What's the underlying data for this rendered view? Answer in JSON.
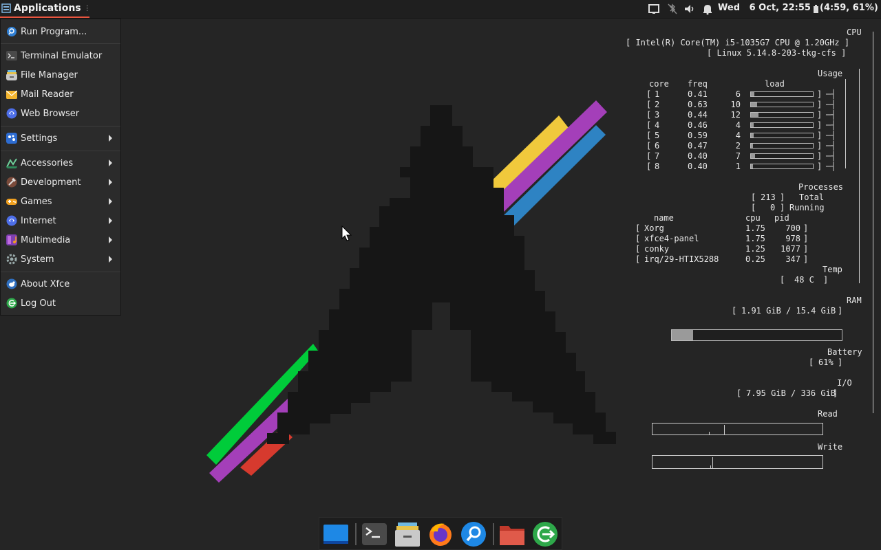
{
  "panel": {
    "apps_label": "Applications",
    "clock": "Wed   6 Oct, 22:55",
    "battery": "(4:59, 61%)"
  },
  "menu": {
    "items": [
      {
        "label": "Run Program...",
        "icon": "search-icon"
      },
      {
        "label": "Terminal Emulator",
        "icon": "terminal-icon"
      },
      {
        "label": "File Manager",
        "icon": "file-manager-icon"
      },
      {
        "label": "Mail Reader",
        "icon": "mail-icon"
      },
      {
        "label": "Web Browser",
        "icon": "web-browser-icon"
      },
      {
        "label": "Settings",
        "icon": "settings-icon"
      },
      {
        "label": "Accessories",
        "icon": "accessories-icon"
      },
      {
        "label": "Development",
        "icon": "development-icon"
      },
      {
        "label": "Games",
        "icon": "games-icon"
      },
      {
        "label": "Internet",
        "icon": "internet-icon"
      },
      {
        "label": "Multimedia",
        "icon": "multimedia-icon"
      },
      {
        "label": "System",
        "icon": "system-icon"
      },
      {
        "label": "About Xfce",
        "icon": "xfce-icon"
      },
      {
        "label": "Log Out",
        "icon": "logout-icon"
      }
    ]
  },
  "conky": {
    "cpu_header": "CPU",
    "cpu_model": "[ Intel(R) Core(TM) i5-1035G7 CPU @ 1.20GHz ]",
    "kernel": "[ Linux 5.14.8-203-tkg-cfs ]",
    "usage_header": "Usage",
    "core_header": "core",
    "freq_header": "freq",
    "load_header": "load",
    "cores": [
      {
        "core": "1",
        "freq": "0.41",
        "load": "6"
      },
      {
        "core": "2",
        "freq": "0.63",
        "load": "10"
      },
      {
        "core": "3",
        "freq": "0.44",
        "load": "12"
      },
      {
        "core": "4",
        "freq": "0.46",
        "load": "4"
      },
      {
        "core": "5",
        "freq": "0.59",
        "load": "4"
      },
      {
        "core": "6",
        "freq": "0.47",
        "load": "2"
      },
      {
        "core": "7",
        "freq": "0.40",
        "load": "7"
      },
      {
        "core": "8",
        "freq": "0.40",
        "load": "1"
      }
    ],
    "processes_header": "Processes",
    "total_count": "213",
    "total_label": "Total",
    "running_count": "0",
    "running_label": "Running",
    "proc_cols": {
      "name": "name",
      "cpu": "cpu",
      "pid": "pid"
    },
    "procs": [
      {
        "name": "Xorg",
        "cpu": "1.75",
        "pid": "700"
      },
      {
        "name": "xfce4-panel",
        "cpu": "1.75",
        "pid": "978"
      },
      {
        "name": "conky",
        "cpu": "1.25",
        "pid": "1077"
      },
      {
        "name": "irq/29-HTIX5288",
        "cpu": "0.25",
        "pid": "347"
      }
    ],
    "temp_header": "Temp",
    "temp": "48 C",
    "ram_header": "RAM",
    "ram": "1.91 GiB / 15.4 GiB",
    "ram_fraction": 0.124,
    "battery_header": "Battery",
    "battery": "61%",
    "io_header": "I/O",
    "io": "7.95 GiB / 336 GiB",
    "read_label": "Read",
    "write_label": "Write"
  },
  "dock": {
    "items": [
      "desktop-icon",
      "terminal-icon",
      "file-manager-icon",
      "firefox-icon",
      "search-icon",
      "folder-icon",
      "logout-icon"
    ]
  }
}
